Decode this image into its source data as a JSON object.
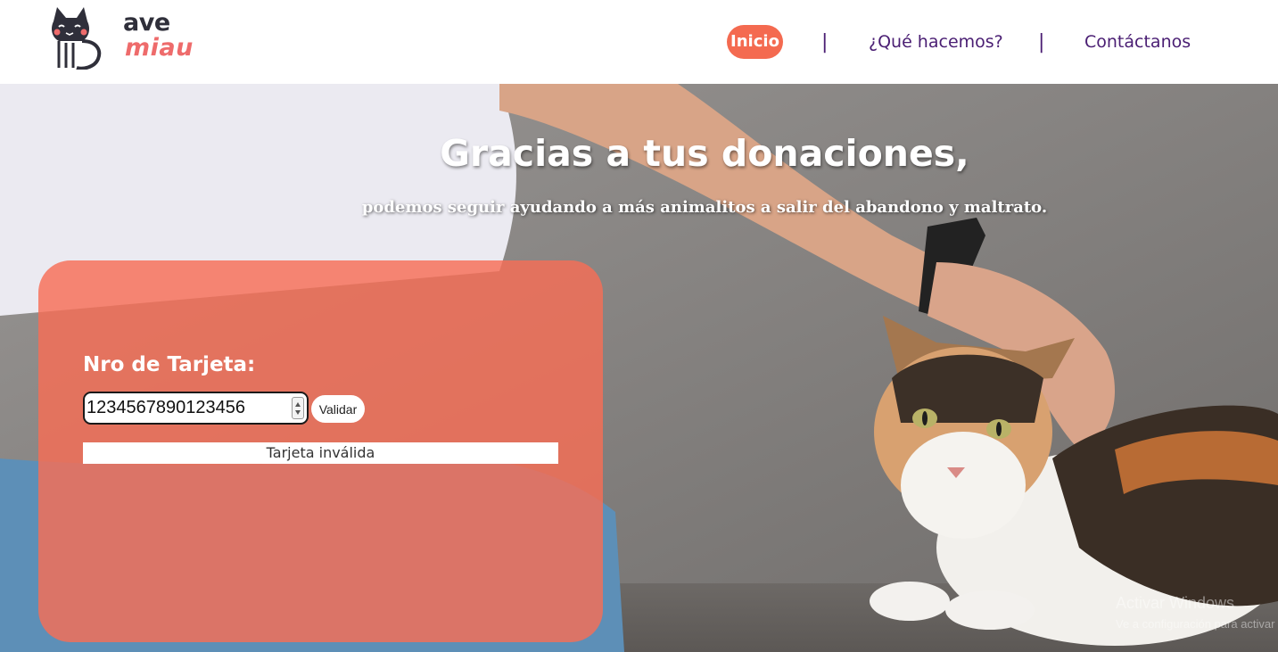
{
  "brand": {
    "logo_line1": "ave",
    "logo_line2": "miau"
  },
  "nav": {
    "home": "Inicio",
    "separator": "|",
    "what_we_do": "¿Qué hacemos?",
    "contact": "Contáctanos"
  },
  "hero": {
    "title": "Gracias a tus donaciones,",
    "subtitle": "podemos seguir ayudando a más animalitos a salir del abandono y maltrato."
  },
  "card_form": {
    "label": "Nro de Tarjeta:",
    "card_number_value": "1234567890123456",
    "validate_button": "Validar",
    "result_message": "Tarjeta inválida"
  },
  "system_watermark": {
    "line1": "Activar Windows",
    "line2": "Ve a configuración para activar Windows."
  },
  "colors": {
    "accent": "#f46a50",
    "nav_text": "#4a1e73",
    "card_overlay": "#f66e56",
    "logo_red": "#ee6b6b",
    "logo_dark": "#2f2f3a"
  }
}
